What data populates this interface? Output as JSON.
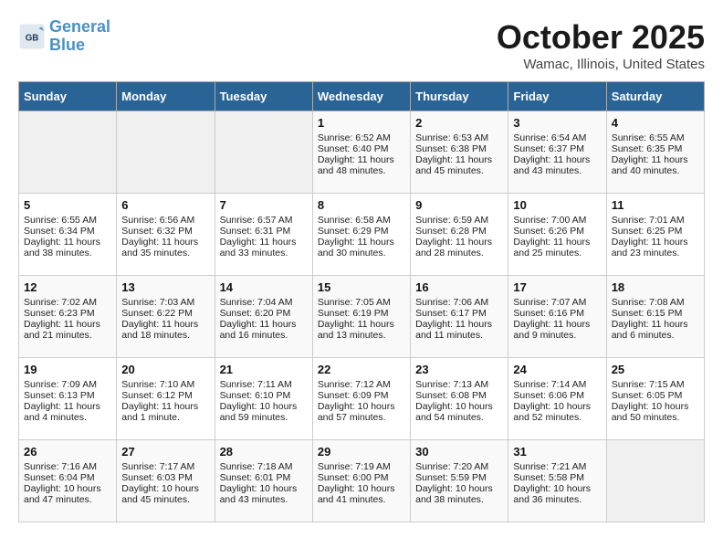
{
  "app": {
    "logo_line1": "General",
    "logo_line2": "Blue"
  },
  "header": {
    "month": "October 2025",
    "location": "Wamac, Illinois, United States"
  },
  "weekdays": [
    "Sunday",
    "Monday",
    "Tuesday",
    "Wednesday",
    "Thursday",
    "Friday",
    "Saturday"
  ],
  "weeks": [
    [
      {
        "day": "",
        "content": ""
      },
      {
        "day": "",
        "content": ""
      },
      {
        "day": "",
        "content": ""
      },
      {
        "day": "1",
        "content": "Sunrise: 6:52 AM\nSunset: 6:40 PM\nDaylight: 11 hours and 48 minutes."
      },
      {
        "day": "2",
        "content": "Sunrise: 6:53 AM\nSunset: 6:38 PM\nDaylight: 11 hours and 45 minutes."
      },
      {
        "day": "3",
        "content": "Sunrise: 6:54 AM\nSunset: 6:37 PM\nDaylight: 11 hours and 43 minutes."
      },
      {
        "day": "4",
        "content": "Sunrise: 6:55 AM\nSunset: 6:35 PM\nDaylight: 11 hours and 40 minutes."
      }
    ],
    [
      {
        "day": "5",
        "content": "Sunrise: 6:55 AM\nSunset: 6:34 PM\nDaylight: 11 hours and 38 minutes."
      },
      {
        "day": "6",
        "content": "Sunrise: 6:56 AM\nSunset: 6:32 PM\nDaylight: 11 hours and 35 minutes."
      },
      {
        "day": "7",
        "content": "Sunrise: 6:57 AM\nSunset: 6:31 PM\nDaylight: 11 hours and 33 minutes."
      },
      {
        "day": "8",
        "content": "Sunrise: 6:58 AM\nSunset: 6:29 PM\nDaylight: 11 hours and 30 minutes."
      },
      {
        "day": "9",
        "content": "Sunrise: 6:59 AM\nSunset: 6:28 PM\nDaylight: 11 hours and 28 minutes."
      },
      {
        "day": "10",
        "content": "Sunrise: 7:00 AM\nSunset: 6:26 PM\nDaylight: 11 hours and 25 minutes."
      },
      {
        "day": "11",
        "content": "Sunrise: 7:01 AM\nSunset: 6:25 PM\nDaylight: 11 hours and 23 minutes."
      }
    ],
    [
      {
        "day": "12",
        "content": "Sunrise: 7:02 AM\nSunset: 6:23 PM\nDaylight: 11 hours and 21 minutes."
      },
      {
        "day": "13",
        "content": "Sunrise: 7:03 AM\nSunset: 6:22 PM\nDaylight: 11 hours and 18 minutes."
      },
      {
        "day": "14",
        "content": "Sunrise: 7:04 AM\nSunset: 6:20 PM\nDaylight: 11 hours and 16 minutes."
      },
      {
        "day": "15",
        "content": "Sunrise: 7:05 AM\nSunset: 6:19 PM\nDaylight: 11 hours and 13 minutes."
      },
      {
        "day": "16",
        "content": "Sunrise: 7:06 AM\nSunset: 6:17 PM\nDaylight: 11 hours and 11 minutes."
      },
      {
        "day": "17",
        "content": "Sunrise: 7:07 AM\nSunset: 6:16 PM\nDaylight: 11 hours and 9 minutes."
      },
      {
        "day": "18",
        "content": "Sunrise: 7:08 AM\nSunset: 6:15 PM\nDaylight: 11 hours and 6 minutes."
      }
    ],
    [
      {
        "day": "19",
        "content": "Sunrise: 7:09 AM\nSunset: 6:13 PM\nDaylight: 11 hours and 4 minutes."
      },
      {
        "day": "20",
        "content": "Sunrise: 7:10 AM\nSunset: 6:12 PM\nDaylight: 11 hours and 1 minute."
      },
      {
        "day": "21",
        "content": "Sunrise: 7:11 AM\nSunset: 6:10 PM\nDaylight: 10 hours and 59 minutes."
      },
      {
        "day": "22",
        "content": "Sunrise: 7:12 AM\nSunset: 6:09 PM\nDaylight: 10 hours and 57 minutes."
      },
      {
        "day": "23",
        "content": "Sunrise: 7:13 AM\nSunset: 6:08 PM\nDaylight: 10 hours and 54 minutes."
      },
      {
        "day": "24",
        "content": "Sunrise: 7:14 AM\nSunset: 6:06 PM\nDaylight: 10 hours and 52 minutes."
      },
      {
        "day": "25",
        "content": "Sunrise: 7:15 AM\nSunset: 6:05 PM\nDaylight: 10 hours and 50 minutes."
      }
    ],
    [
      {
        "day": "26",
        "content": "Sunrise: 7:16 AM\nSunset: 6:04 PM\nDaylight: 10 hours and 47 minutes."
      },
      {
        "day": "27",
        "content": "Sunrise: 7:17 AM\nSunset: 6:03 PM\nDaylight: 10 hours and 45 minutes."
      },
      {
        "day": "28",
        "content": "Sunrise: 7:18 AM\nSunset: 6:01 PM\nDaylight: 10 hours and 43 minutes."
      },
      {
        "day": "29",
        "content": "Sunrise: 7:19 AM\nSunset: 6:00 PM\nDaylight: 10 hours and 41 minutes."
      },
      {
        "day": "30",
        "content": "Sunrise: 7:20 AM\nSunset: 5:59 PM\nDaylight: 10 hours and 38 minutes."
      },
      {
        "day": "31",
        "content": "Sunrise: 7:21 AM\nSunset: 5:58 PM\nDaylight: 10 hours and 36 minutes."
      },
      {
        "day": "",
        "content": ""
      }
    ]
  ]
}
